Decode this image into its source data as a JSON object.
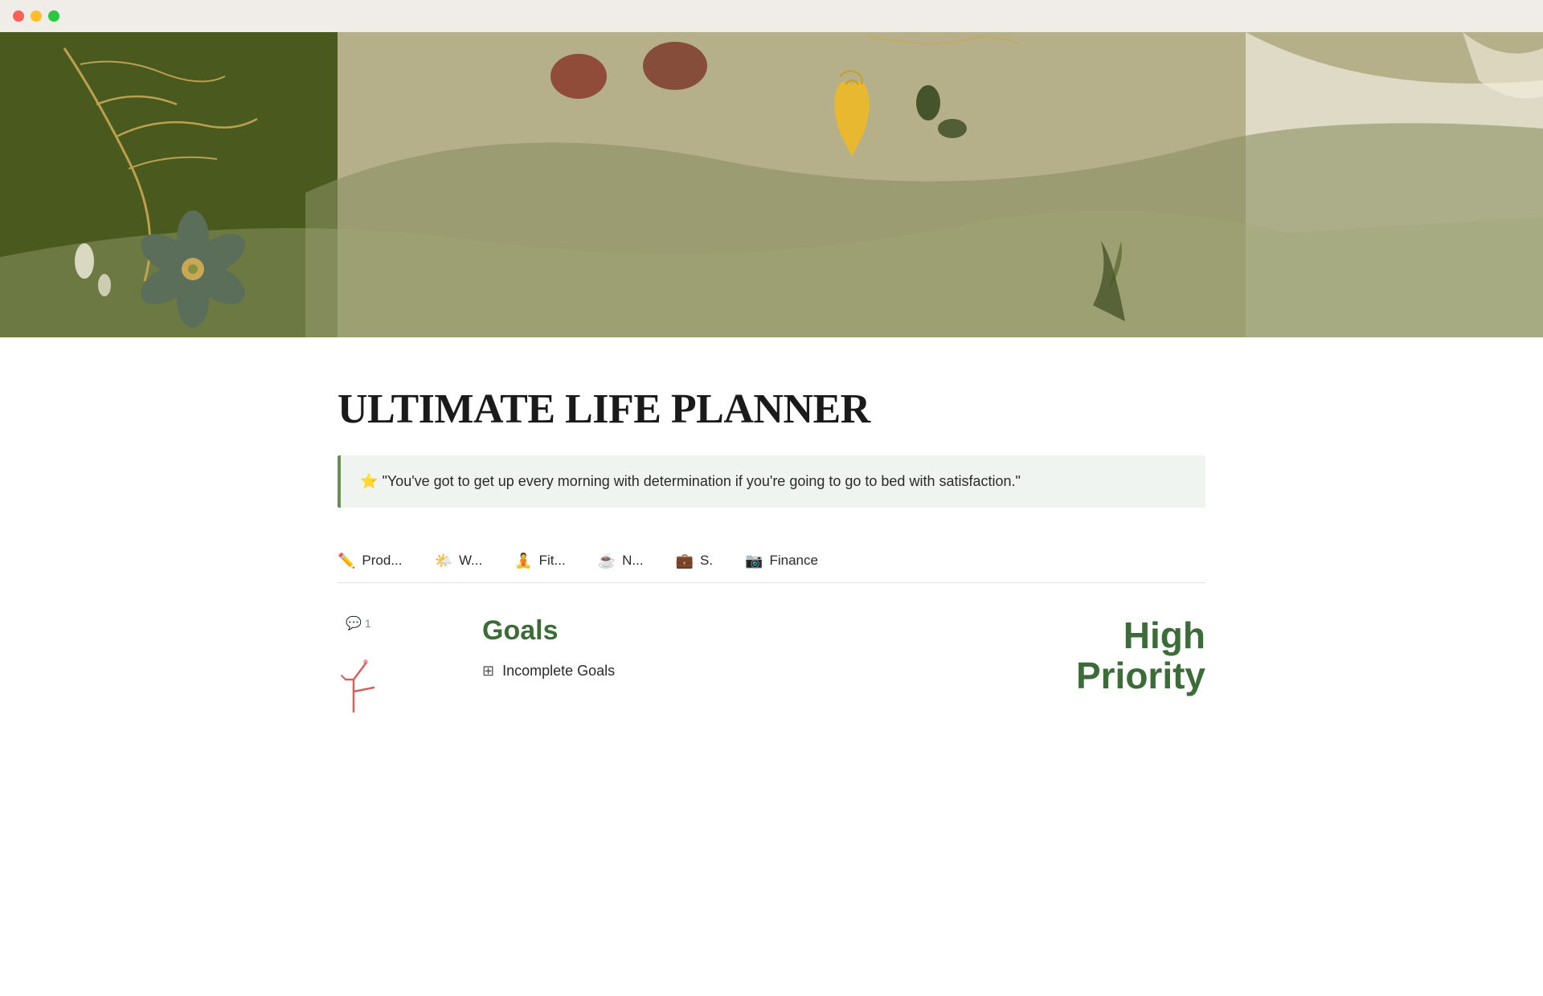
{
  "window": {
    "traffic_lights": {
      "close": "close",
      "minimize": "minimize",
      "maximize": "maximize"
    }
  },
  "hero": {
    "alt": "Decorative botanical banner"
  },
  "page": {
    "title": "ULTIMATE LIFE PLANNER",
    "quote": {
      "emoji": "⭐",
      "text": "\"You've got to get up every morning with determination if you're going to go to bed with satisfaction.\""
    }
  },
  "nav_tabs": [
    {
      "id": "productivity",
      "icon": "✏️",
      "label": "Prod..."
    },
    {
      "id": "wellness",
      "icon": "🌤️",
      "label": "W..."
    },
    {
      "id": "fitness",
      "icon": "🧘",
      "label": "Fit..."
    },
    {
      "id": "nutrition",
      "icon": "☕",
      "label": "N..."
    },
    {
      "id": "schedule",
      "icon": "💼",
      "label": "S."
    },
    {
      "id": "finance",
      "icon": "📷",
      "label": "Finance"
    }
  ],
  "bottom": {
    "comment_count": "1",
    "goals_title": "Goals",
    "incomplete_goals_label": "Incomplete Goals",
    "priority_line1": "High",
    "priority_line2": "Priority"
  },
  "colors": {
    "green_dark": "#3d6b3a",
    "quote_bg": "#f0f4f0",
    "quote_border": "#6b8c5a"
  }
}
